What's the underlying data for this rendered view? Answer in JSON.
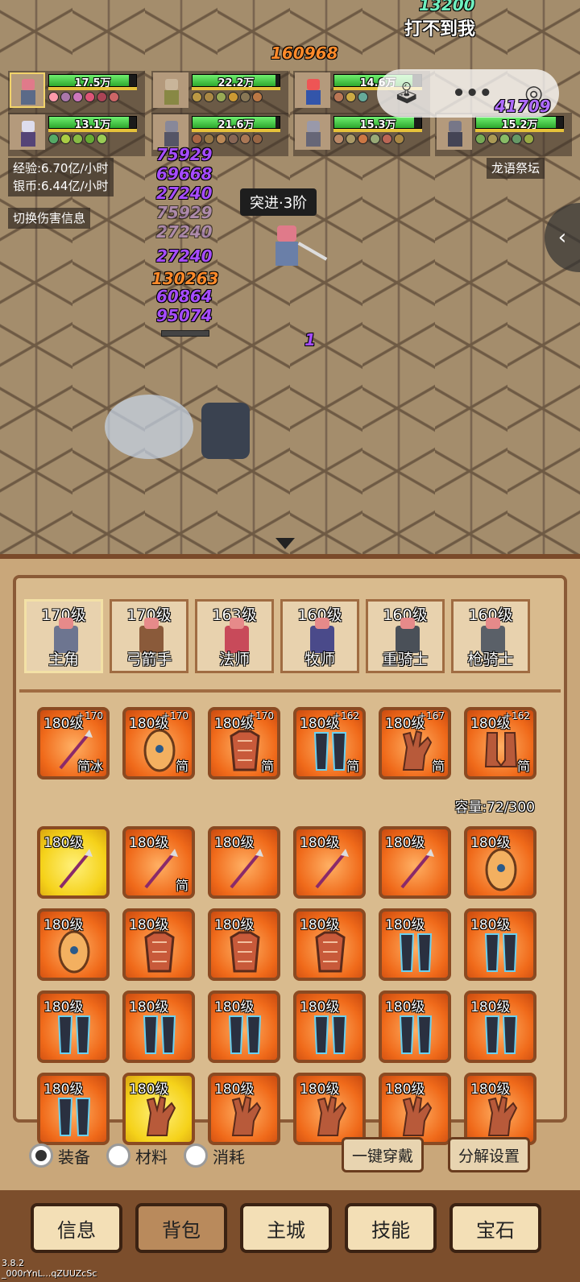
{
  "battle": {
    "party": [
      {
        "hp": "17.5万",
        "hp_fraction": 0.92
      },
      {
        "hp": "22.2万",
        "hp_fraction": 0.95
      },
      {
        "hp": "14.6万",
        "hp_fraction": 0.9
      },
      {
        "hp": "13.1万",
        "hp_fraction": 0.92
      },
      {
        "hp": "21.6万",
        "hp_fraction": 0.95
      },
      {
        "hp": "15.3万",
        "hp_fraction": 0.92
      },
      {
        "hp": "15.2万",
        "hp_fraction": 0.92
      }
    ],
    "exp_rate": "经验:6.70亿/小时",
    "silver_rate": "银币:6.44亿/小时",
    "toggle_damage_info": "切换伤害信息",
    "location": "龙语祭坛",
    "skill_banner": "突进·3阶",
    "enemy_taunt": "打不到我",
    "damage_numbers": [
      "13200",
      "160968",
      "41709",
      "75929",
      "69668",
      "27240",
      "75929",
      "27240",
      "27240",
      "130263",
      "60864",
      "95074",
      "1"
    ]
  },
  "team": [
    {
      "level": "170级",
      "name": "主角"
    },
    {
      "level": "170级",
      "name": "弓箭手"
    },
    {
      "level": "163级",
      "name": "法师"
    },
    {
      "level": "160级",
      "name": "牧师"
    },
    {
      "level": "160级",
      "name": "重骑士"
    },
    {
      "level": "160级",
      "name": "枪骑士"
    }
  ],
  "equipped": [
    {
      "level": "180级",
      "plus": "+170",
      "tag": "简冰",
      "icon": "spear-icon"
    },
    {
      "level": "180级",
      "plus": "+170",
      "tag": "简",
      "icon": "shield-icon"
    },
    {
      "level": "180级",
      "plus": "+170",
      "tag": "简",
      "icon": "armor-icon"
    },
    {
      "level": "180级",
      "plus": "+162",
      "tag": "简",
      "icon": "leg-armor-icon"
    },
    {
      "level": "180级",
      "plus": "+167",
      "tag": "简",
      "icon": "gauntlet-icon"
    },
    {
      "level": "180级",
      "plus": "+162",
      "tag": "简",
      "icon": "boots-icon"
    }
  ],
  "capacity": "容量:72/300",
  "bag": [
    {
      "level": "180级",
      "tag": "",
      "icon": "spear-icon",
      "rarity": "gold"
    },
    {
      "level": "180级",
      "tag": "简",
      "icon": "spear-icon",
      "rarity": "orange"
    },
    {
      "level": "180级",
      "tag": "",
      "icon": "spear-icon",
      "rarity": "orange"
    },
    {
      "level": "180级",
      "tag": "",
      "icon": "spear-icon",
      "rarity": "orange"
    },
    {
      "level": "180级",
      "tag": "",
      "icon": "spear-icon",
      "rarity": "orange"
    },
    {
      "level": "180级",
      "tag": "",
      "icon": "shield-icon",
      "rarity": "orange"
    },
    {
      "level": "180级",
      "tag": "",
      "icon": "shield-icon",
      "rarity": "orange"
    },
    {
      "level": "180级",
      "tag": "",
      "icon": "armor-icon",
      "rarity": "orange"
    },
    {
      "level": "180级",
      "tag": "",
      "icon": "armor-icon",
      "rarity": "orange"
    },
    {
      "level": "180级",
      "tag": "",
      "icon": "armor-icon",
      "rarity": "orange"
    },
    {
      "level": "180级",
      "tag": "",
      "icon": "leg-armor-icon",
      "rarity": "orange"
    },
    {
      "level": "180级",
      "tag": "",
      "icon": "leg-armor-icon",
      "rarity": "orange"
    },
    {
      "level": "180级",
      "tag": "",
      "icon": "leg-armor-icon",
      "rarity": "orange"
    },
    {
      "level": "180级",
      "tag": "",
      "icon": "leg-armor-icon",
      "rarity": "orange"
    },
    {
      "level": "180级",
      "tag": "",
      "icon": "leg-armor-icon",
      "rarity": "orange"
    },
    {
      "level": "180级",
      "tag": "",
      "icon": "leg-armor-icon",
      "rarity": "orange"
    },
    {
      "level": "180级",
      "tag": "",
      "icon": "leg-armor-icon",
      "rarity": "orange"
    },
    {
      "level": "180级",
      "tag": "",
      "icon": "leg-armor-icon",
      "rarity": "orange"
    },
    {
      "level": "180级",
      "tag": "",
      "icon": "leg-armor-icon",
      "rarity": "orange"
    },
    {
      "level": "180级",
      "tag": "",
      "icon": "gauntlet-icon",
      "rarity": "gold"
    },
    {
      "level": "180级",
      "tag": "",
      "icon": "gauntlet-icon",
      "rarity": "orange"
    },
    {
      "level": "180级",
      "tag": "",
      "icon": "gauntlet-icon",
      "rarity": "orange"
    },
    {
      "level": "180级",
      "tag": "",
      "icon": "gauntlet-icon",
      "rarity": "orange"
    },
    {
      "level": "180级",
      "tag": "",
      "icon": "gauntlet-icon",
      "rarity": "orange"
    }
  ],
  "filters": [
    {
      "label": "装备",
      "selected": true
    },
    {
      "label": "材料",
      "selected": false
    },
    {
      "label": "消耗",
      "selected": false
    }
  ],
  "actions": {
    "equip_all": "一键穿戴",
    "salvage_settings": "分解设置"
  },
  "nav": [
    {
      "label": "信息"
    },
    {
      "label": "背包",
      "active": true
    },
    {
      "label": "主城"
    },
    {
      "label": "技能"
    },
    {
      "label": "宝石"
    }
  ],
  "version": {
    "line1": "3.8.2",
    "line2": "_000rYnL...qZUUZcSc"
  },
  "colors": {
    "hp_green": "#2ea82e",
    "item_orange": "#f06a1a",
    "item_gold": "#f5d21a",
    "panel_brown": "#8a5a36"
  }
}
